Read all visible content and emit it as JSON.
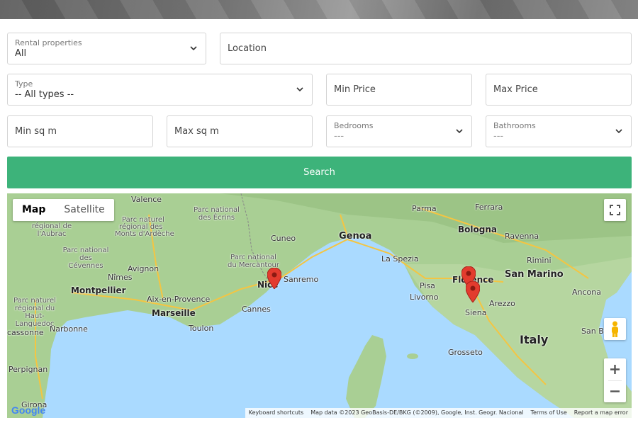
{
  "form": {
    "rental": {
      "label": "Rental properties",
      "value": "All"
    },
    "location": {
      "placeholder": "Location"
    },
    "type": {
      "label": "Type",
      "value": "-- All types --"
    },
    "min_price": {
      "placeholder": "Min Price"
    },
    "max_price": {
      "placeholder": "Max Price"
    },
    "min_sqm": {
      "placeholder": "Min sq m"
    },
    "max_sqm": {
      "placeholder": "Max sq m"
    },
    "bedrooms": {
      "label": "Bedrooms",
      "value": "---"
    },
    "bathrooms": {
      "label": "Bathrooms",
      "value": "---"
    },
    "search_label": "Search"
  },
  "map": {
    "type_map": "Map",
    "type_satellite": "Satellite",
    "google": "Google",
    "footer": {
      "shortcuts": "Keyboard shortcuts",
      "data": "Map data ©2023 GeoBasis-DE/BKG (©2009), Google, Inst. Geogr. Nacional",
      "terms": "Terms of Use",
      "report": "Report a map error"
    },
    "places": {
      "valence": "Valence",
      "parc_naturel_monts": "Parc naturel régional des Monts d'Ardèche",
      "parc_ecrins": "Parc national des Écrins",
      "aubrac": "Parc naturel régional de l'Aubrac",
      "cevennes": "Parc national des Cévennes",
      "mercantour": "Parc national du Mercantour",
      "nimes": "Nîmes",
      "avignon": "Avignon",
      "montpellier": "Montpellier",
      "aix": "Aix-en-Provence",
      "marseille": "Marseille",
      "toulon": "Toulon",
      "cannes": "Cannes",
      "nice": "Nice",
      "sanremo": "Sanremo",
      "cuneo": "Cuneo",
      "genoa": "Genoa",
      "parma": "Parma",
      "bologna": "Bologna",
      "ferrara": "Ferrara",
      "ravenna": "Ravenna",
      "rimini": "Rimini",
      "san_marino": "San Marino",
      "la_spezia": "La Spezia",
      "pisa": "Pisa",
      "livorno": "Livorno",
      "florence": "Florence",
      "siena": "Siena",
      "arezzo": "Arezzo",
      "ancona": "Ancona",
      "grosseto": "Grosseto",
      "italy": "Italy",
      "san_be": "San Be",
      "haut_languedoc": "Parc naturel régional du Haut-Languedoc",
      "narbonne": "Narbonne",
      "carcassonne": "cassonne",
      "perpignan": "Perpignan",
      "girona": "Girona",
      "parc_naturel_top": "Parc naturel",
      "parc_naturel_top2": "régional des",
      "parc_naturel_top3": "Monts d'Ardèche"
    }
  }
}
